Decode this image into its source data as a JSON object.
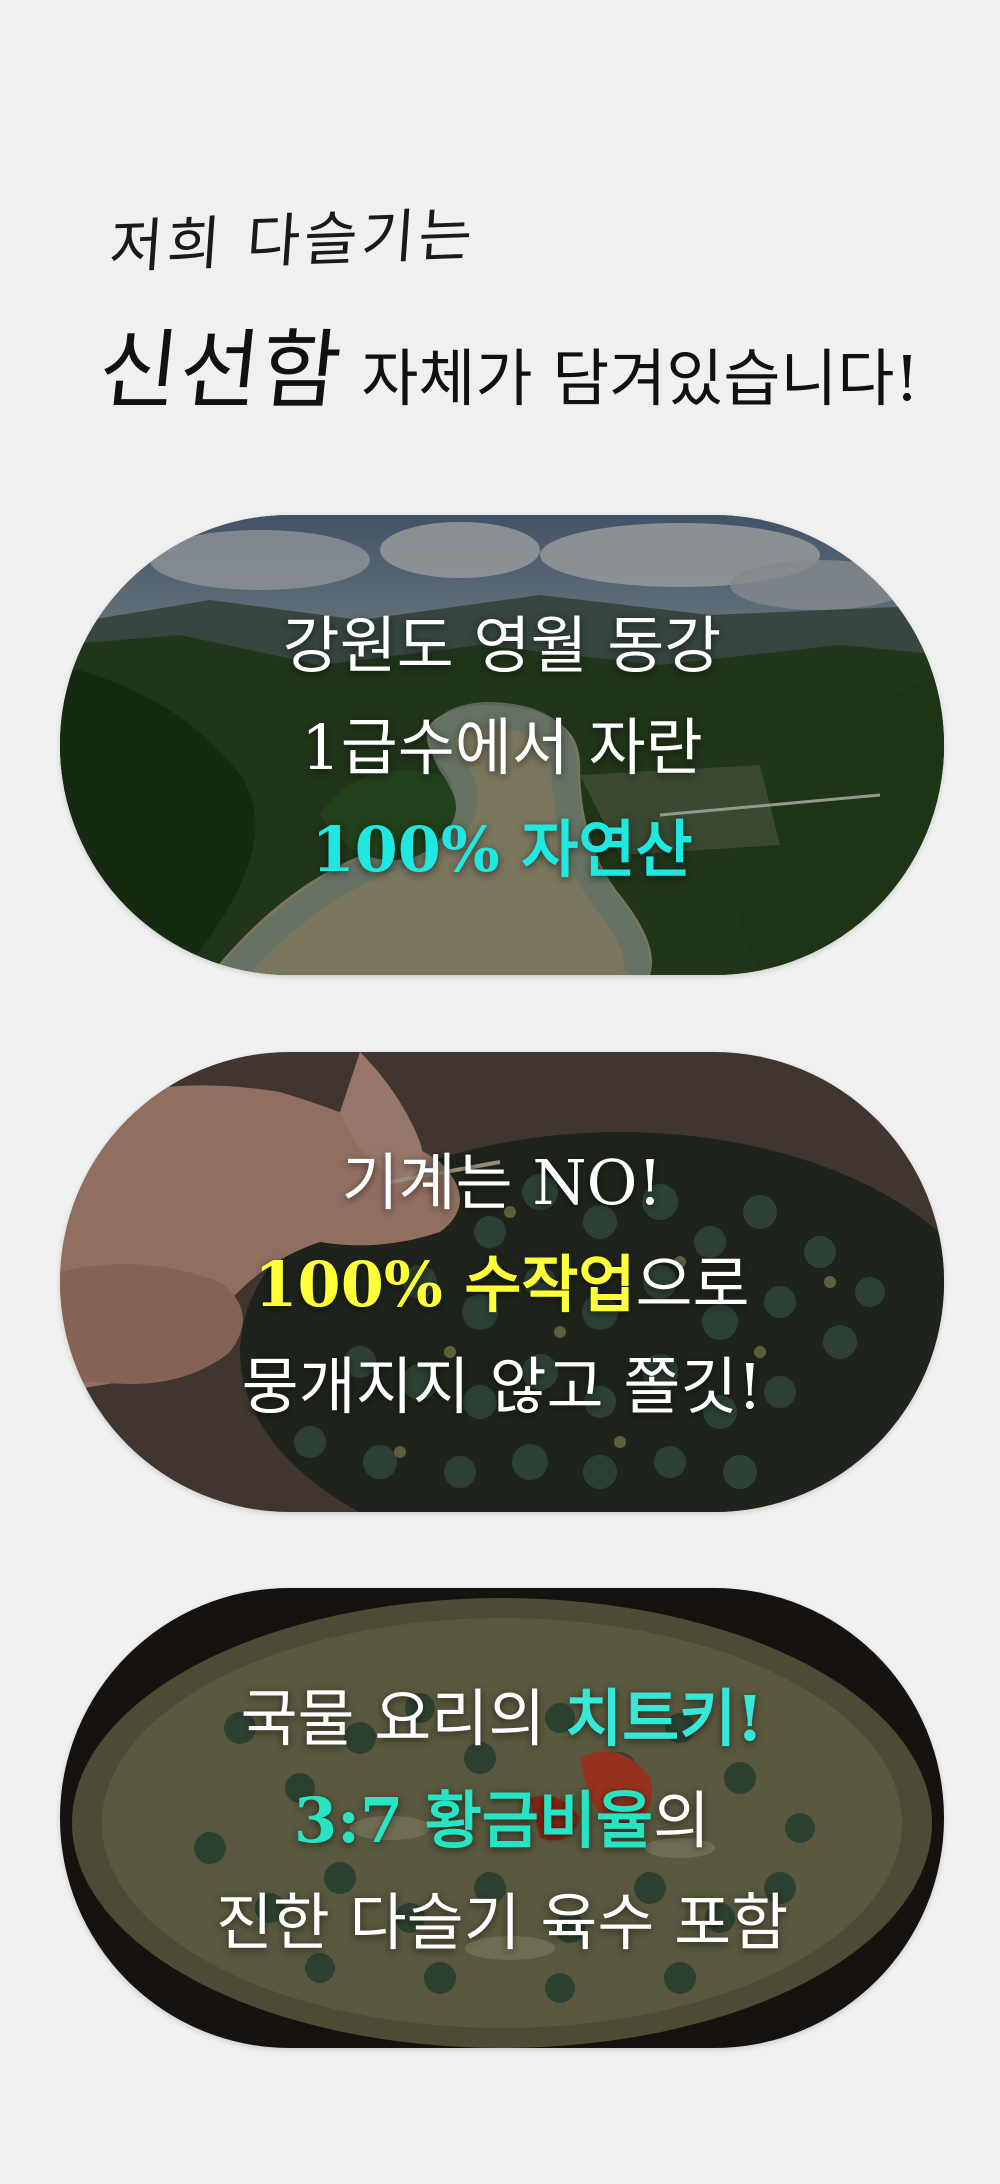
{
  "intro": {
    "line1": "저희 다슬기는",
    "line2_emphasis": "신선함",
    "line2_rest": "자체가 담겨있습니다!"
  },
  "cards": [
    {
      "image": "mountain-river-valley",
      "line1": "강원도 영월 동강",
      "line2": "1급수에서 자란",
      "line3_highlight": "100% 자연산",
      "highlight_color": "#1ee8e0"
    },
    {
      "image": "hands-picking-snails",
      "line1": "기계는 NO!",
      "line2_highlight": "100% 수작업",
      "line2_rest": "으로",
      "line3": "뭉개지지 않고 쫄깃!",
      "highlight_color": "#ffff3a"
    },
    {
      "image": "snail-soup-bowl",
      "line1_lead": "국물 요리의",
      "line1_highlight": "치트키!",
      "line2_highlight": "3:7 황금비율",
      "line2_rest": "의",
      "line3": "진한 다슬기 육수 포함",
      "highlight_color": "#26e4c4"
    }
  ]
}
